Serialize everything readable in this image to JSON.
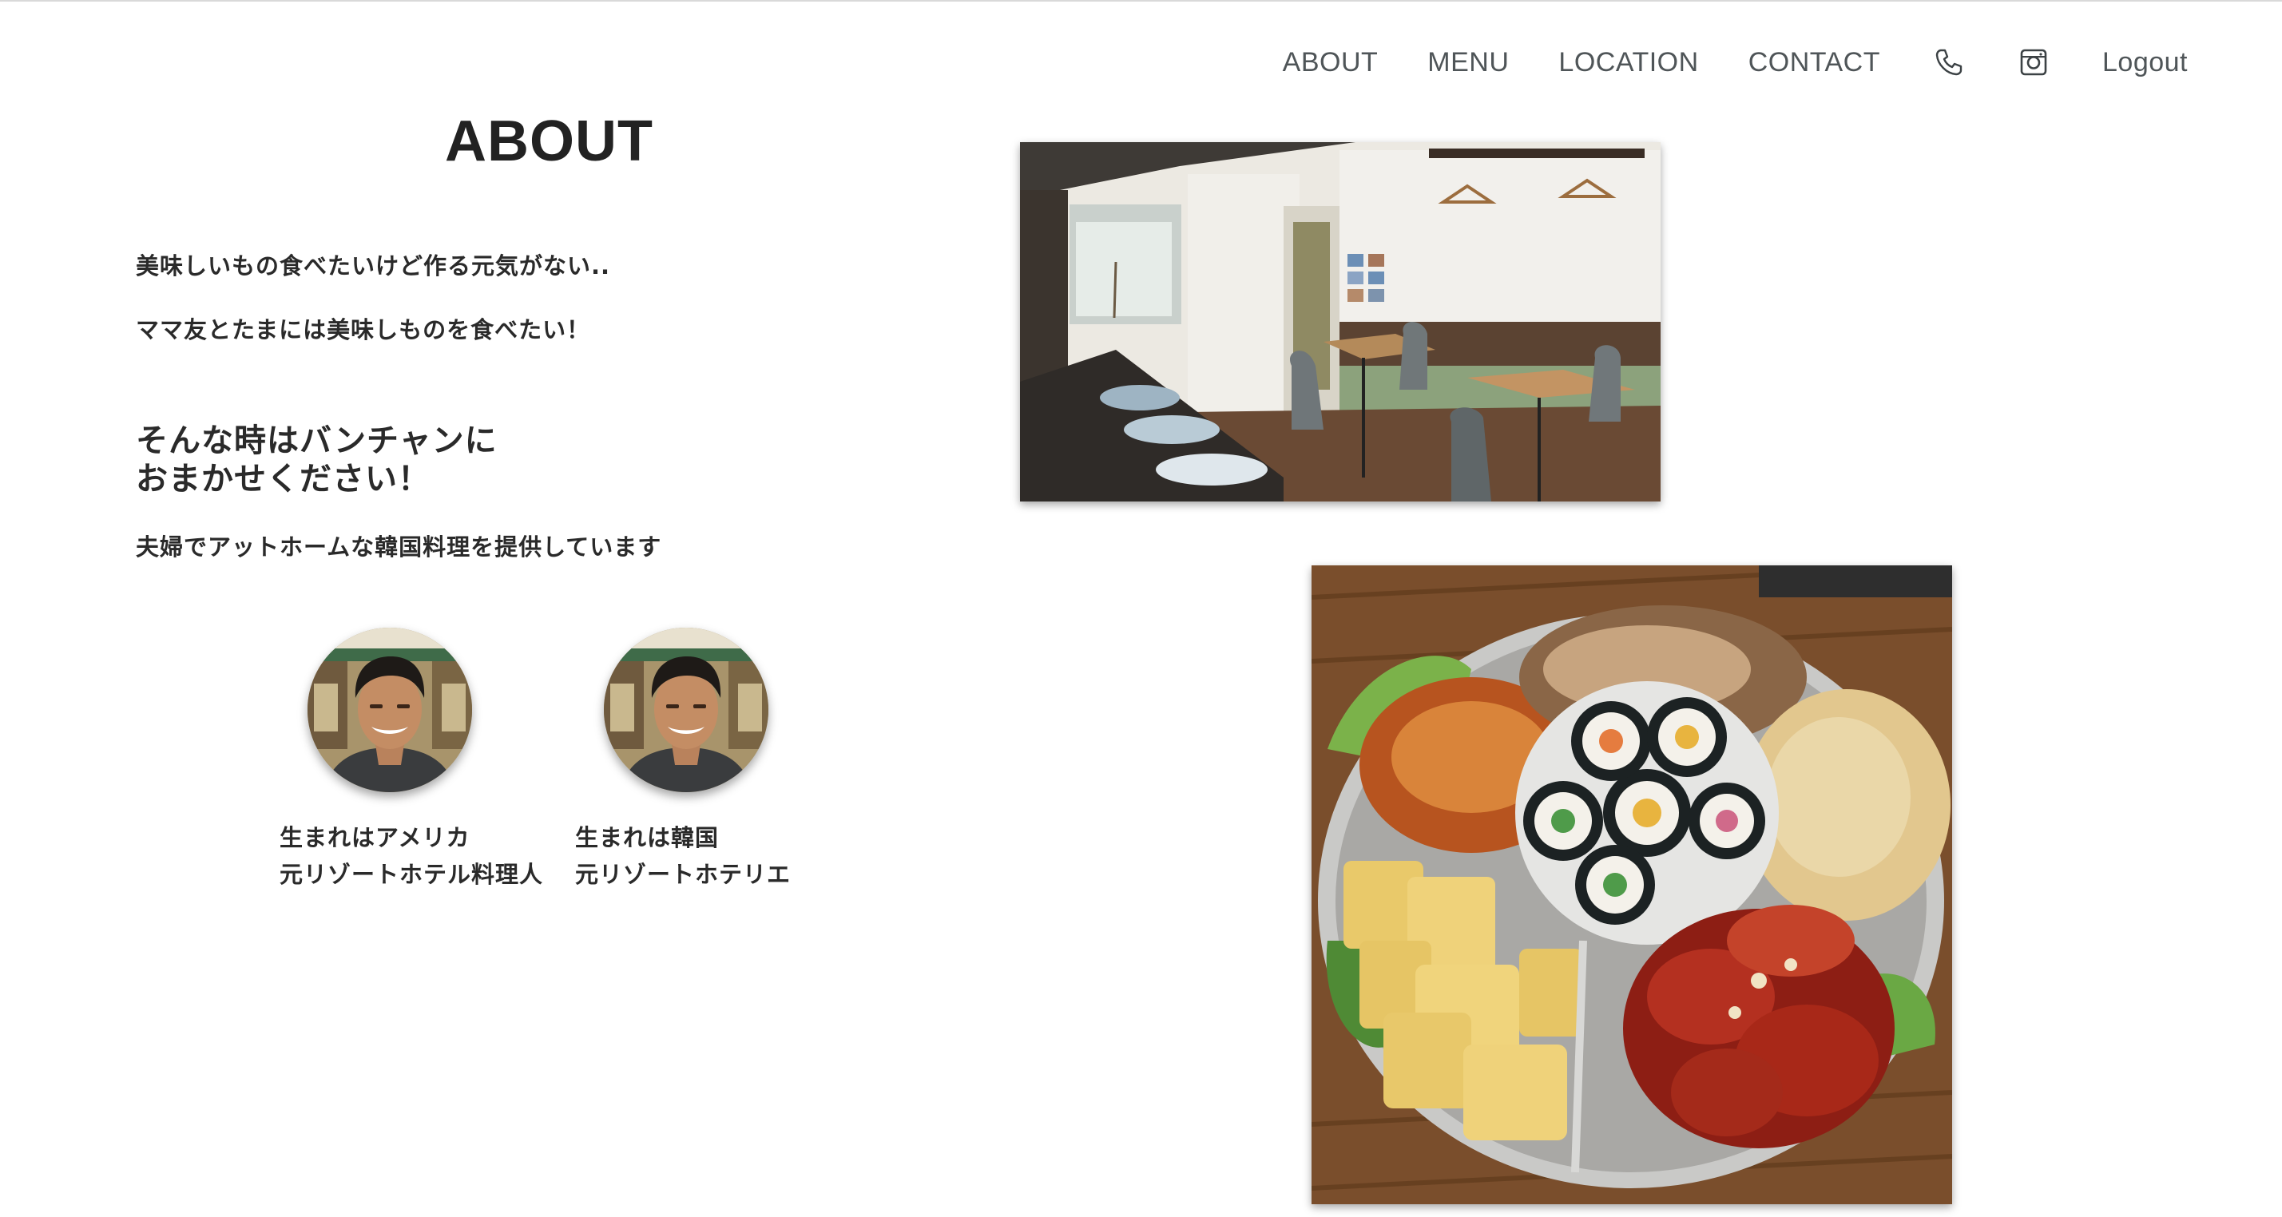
{
  "nav": {
    "items": [
      {
        "label": "ABOUT"
      },
      {
        "label": "MENU"
      },
      {
        "label": "LOCATION"
      },
      {
        "label": "CONTACT"
      }
    ],
    "phone_icon": "phone-icon",
    "instagram_icon": "instagram-icon",
    "logout_label": "Logout"
  },
  "about": {
    "title": "ABOUT",
    "line1": "美味しいもの食べたいけど作る元気がない..",
    "line2": "ママ友とたまには美味しものを食べたい！",
    "headline_line1": "そんな時はバンチャンに",
    "headline_line2": "おまかせください！",
    "line3": "夫婦でアットホームな韓国料理を提供しています"
  },
  "staff": [
    {
      "caption_line1": "生まれはアメリカ",
      "caption_line2": "元リゾートホテル料理人"
    },
    {
      "caption_line1": "生まれは韓国",
      "caption_line2": "元リゾートホテリエ"
    }
  ],
  "colors": {
    "nav_text": "#4f5558",
    "heading": "#222222",
    "body_text": "#2a2a2a"
  }
}
